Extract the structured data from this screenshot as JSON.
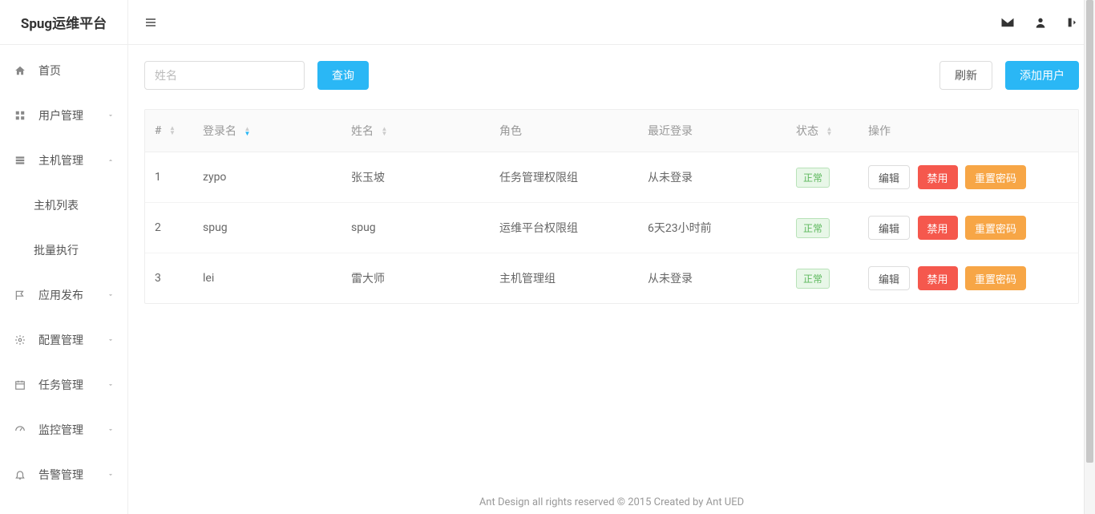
{
  "app": {
    "title": "Spug运维平台"
  },
  "sidebar": {
    "items": [
      {
        "label": "首页",
        "icon": "home"
      },
      {
        "label": "用户管理",
        "icon": "grid",
        "chevron": "down"
      },
      {
        "label": "主机管理",
        "icon": "server",
        "chevron": "up"
      },
      {
        "label": "主机列表",
        "indent": true
      },
      {
        "label": "批量执行",
        "indent": true
      },
      {
        "label": "应用发布",
        "icon": "flag",
        "chevron": "down"
      },
      {
        "label": "配置管理",
        "icon": "gear",
        "chevron": "down"
      },
      {
        "label": "任务管理",
        "icon": "calendar",
        "chevron": "down"
      },
      {
        "label": "监控管理",
        "icon": "dashboard",
        "chevron": "down"
      },
      {
        "label": "告警管理",
        "icon": "bell",
        "chevron": "down"
      }
    ]
  },
  "toolbar": {
    "search_placeholder": "姓名",
    "query_label": "查询",
    "refresh_label": "刷新",
    "add_label": "添加用户"
  },
  "table": {
    "columns": [
      "#",
      "登录名",
      "姓名",
      "角色",
      "最近登录",
      "状态",
      "操作"
    ],
    "rows": [
      {
        "idx": "1",
        "login": "zypo",
        "name": "张玉坡",
        "role": "任务管理权限组",
        "last_login": "从未登录",
        "status": "正常"
      },
      {
        "idx": "2",
        "login": "spug",
        "name": "spug",
        "role": "运维平台权限组",
        "last_login": "6天23小时前",
        "status": "正常"
      },
      {
        "idx": "3",
        "login": "lei",
        "name": "雷大师",
        "role": "主机管理组",
        "last_login": "从未登录",
        "status": "正常"
      }
    ],
    "actions": {
      "edit": "编辑",
      "disable": "禁用",
      "reset": "重置密码"
    }
  },
  "footer": {
    "text": "Ant Design all rights reserved © 2015 Created by Ant UED"
  }
}
